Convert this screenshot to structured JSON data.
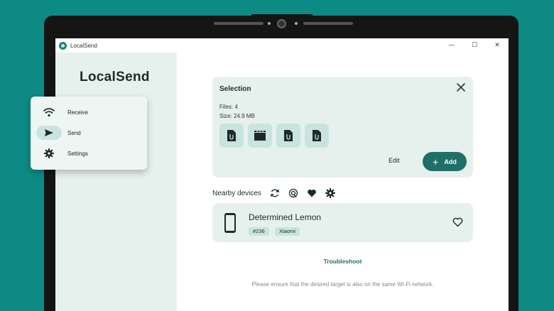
{
  "window": {
    "title": "LocalSend",
    "controls": [
      "—",
      "☐",
      "✕"
    ]
  },
  "sidebar": {
    "logo": "LocalSend",
    "items": [
      {
        "label": "Receive",
        "icon": "wifi-icon",
        "active": false
      },
      {
        "label": "Send",
        "icon": "send-icon",
        "active": true
      },
      {
        "label": "Settings",
        "icon": "gear-icon",
        "active": false
      }
    ]
  },
  "selection": {
    "title": "Selection",
    "files": "Files: 4",
    "size": "Size: 24.9 MB",
    "thumbnails": [
      "file-icon",
      "video-icon",
      "file-icon",
      "file-icon"
    ],
    "edit_label": "Edit",
    "add_label": "Add",
    "add_symbol": "+"
  },
  "nearby": {
    "label": "Nearby devices",
    "icons": [
      "refresh-icon",
      "scan-icon",
      "heart-icon",
      "gear-icon"
    ]
  },
  "device": {
    "name": "Determined Lemon",
    "tags": [
      "#236",
      "Xiaomi"
    ]
  },
  "troubleshoot": "Troubleshoot",
  "hint": "Please ensure that the desired target is also on the same Wi-Fi network.",
  "colors": {
    "background": "#0e8a84",
    "accent": "#1f6f68",
    "card": "#e6f1ee",
    "chip": "#c9e4de"
  }
}
